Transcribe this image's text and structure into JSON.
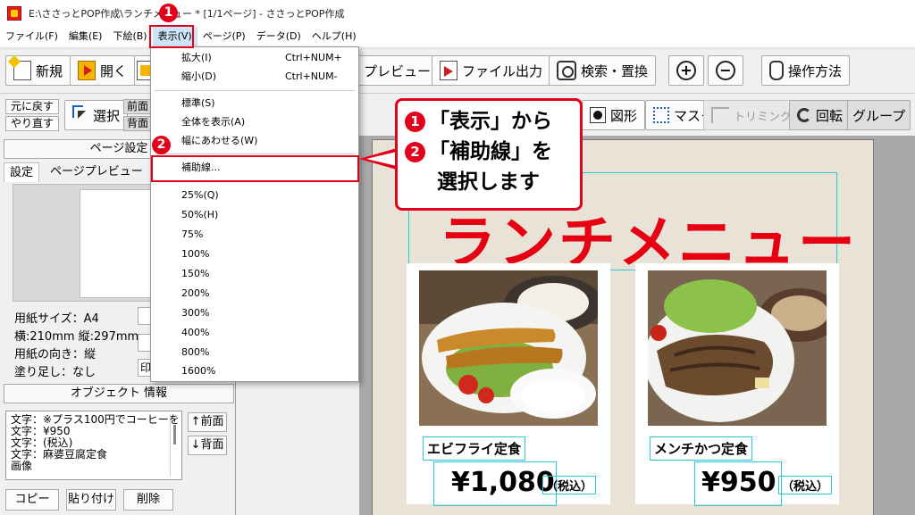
{
  "window": {
    "title": "E:\\ささっとPOP作成\\ランチメニュー  *  [1/1ページ] - ささっとPOP作成"
  },
  "menubar": [
    {
      "label": "ファイル(F)"
    },
    {
      "label": "編集(E)"
    },
    {
      "label": "下絵(B)"
    },
    {
      "label": "表示(V)"
    },
    {
      "label": "ページ(P)"
    },
    {
      "label": "データ(D)"
    },
    {
      "label": "ヘルプ(H)"
    }
  ],
  "toolbar1": {
    "new": "新規",
    "open": "開く",
    "preview": "プレビュー",
    "export": "ファイル出力",
    "search": "検索・置換",
    "howto": "操作方法",
    "zoom_in": "+",
    "zoom_out": "−"
  },
  "toolbar2": {
    "undo": "元に戻す",
    "redo": "やり直す",
    "select": "選択",
    "front": "前面",
    "back": "背面",
    "shape": "図形",
    "mask": "マスク",
    "trim": "トリミング",
    "rotate": "回転",
    "group": "グループ"
  },
  "left_panel": {
    "page_settings": "ページ設定",
    "tabs": [
      "設定",
      "ページプレビュー"
    ],
    "info": [
      "用紙サイズ：A4",
      "横:210mm 縦:297mm",
      "用紙の向き：縦",
      "塗り足し：なし"
    ],
    "print_label": "印",
    "object_info": "オブジェクト 情報",
    "objects": [
      "文字：※プラス100円でコーヒーを",
      "文字：¥950",
      "文字：(税込)",
      "文字：麻婆豆腐定食",
      "画像"
    ],
    "bring_front": "↑前面",
    "send_back": "↓背面",
    "copy": "コピー",
    "paste": "貼り付け",
    "delete": "削除"
  },
  "view_menu": {
    "items": [
      {
        "label": "拡大(I)",
        "shortcut": "Ctrl+NUM+"
      },
      {
        "label": "縮小(D)",
        "shortcut": "Ctrl+NUM-"
      },
      {
        "label": "標準(S)",
        "shortcut": ""
      },
      {
        "label": "全体を表示(A)",
        "shortcut": ""
      },
      {
        "label": "幅にあわせる(W)",
        "shortcut": ""
      },
      {
        "label": "補助線...",
        "shortcut": ""
      },
      {
        "label": "25%(Q)",
        "shortcut": ""
      },
      {
        "label": "50%(H)",
        "shortcut": ""
      },
      {
        "label": "75%",
        "shortcut": ""
      },
      {
        "label": "100%",
        "shortcut": ""
      },
      {
        "label": "150%",
        "shortcut": ""
      },
      {
        "label": "200%",
        "shortcut": ""
      },
      {
        "label": "300%",
        "shortcut": ""
      },
      {
        "label": "400%",
        "shortcut": ""
      },
      {
        "label": "800%",
        "shortcut": ""
      },
      {
        "label": "1600%",
        "shortcut": ""
      }
    ]
  },
  "canvas": {
    "title": "ランチメニュー",
    "cards": [
      {
        "name": "エビフライ定食",
        "price": "¥1,080",
        "tax": "（税込）"
      },
      {
        "name": "メンチかつ定食",
        "price": "¥950",
        "tax": "（税込）"
      }
    ]
  },
  "annotation": {
    "step1_badge": "1",
    "step2_badge": "2",
    "line1": "「表示」から",
    "line2": "「補助線」を",
    "line3": "選択します"
  },
  "colors": {
    "accent_red": "#e2001a",
    "guide_cyan": "#29c9d6",
    "title_red": "#e60012"
  }
}
